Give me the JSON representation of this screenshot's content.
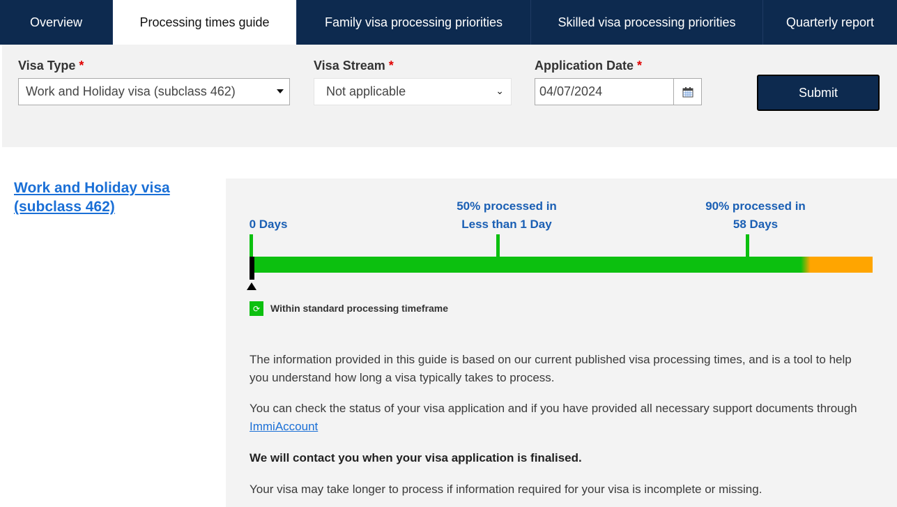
{
  "tabs": [
    {
      "label": "Overview",
      "active": false
    },
    {
      "label": "Processing times guide",
      "active": true
    },
    {
      "label": "Family visa processing priorities",
      "active": false
    },
    {
      "label": "Skilled visa processing priorities",
      "active": false
    },
    {
      "label": "Quarterly report",
      "active": false
    }
  ],
  "form": {
    "visa_type_label": "Visa Type",
    "visa_type_value": "Work and Holiday visa (subclass 462)",
    "visa_stream_label": "Visa Stream",
    "visa_stream_value": "Not applicable",
    "date_label": "Application Date",
    "date_value": "04/07/2024",
    "required_mark": "*",
    "submit_label": "Submit"
  },
  "result": {
    "visa_title": "Work and Holiday visa (subclass 462)",
    "markers": [
      {
        "line1": "",
        "line2": "0 Days"
      },
      {
        "line1": "50% processed in",
        "line2": "Less than 1 Day"
      },
      {
        "line1": "90% processed in",
        "line2": "58 Days"
      }
    ],
    "legend": "Within standard processing timeframe",
    "colors": {
      "within": "#0cc00f",
      "beyond": "#ffa500",
      "marker_text": "#1a5fb4"
    },
    "para1": "The information provided in this guide is based on our current published visa processing times, and is a tool to help you understand how long a visa typically takes to process.",
    "para2_text": "You can check the status of your visa application and if you have provided all necessary support documents through ",
    "para2_link": "ImmiAccount",
    "para3": "We will contact you when your visa application is finalised.",
    "para4": "Your visa may take longer to process if information required for your visa is incomplete or missing."
  }
}
